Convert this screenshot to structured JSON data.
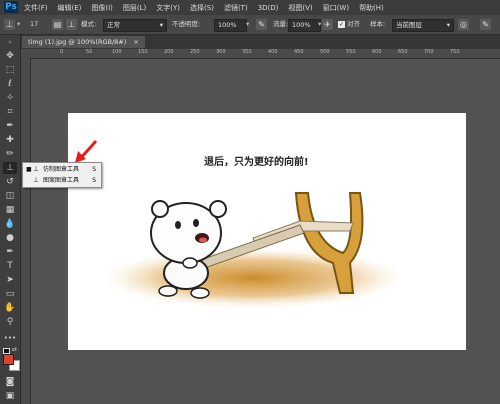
{
  "app": {
    "logo": "Ps"
  },
  "menu": [
    "文件(F)",
    "编辑(E)",
    "图像(I)",
    "图层(L)",
    "文字(Y)",
    "选择(S)",
    "滤镜(T)",
    "3D(D)",
    "视图(V)",
    "窗口(W)",
    "帮助(H)"
  ],
  "options": {
    "brush_size": "17",
    "mode_label": "模式:",
    "mode_value": "正常",
    "opacity_label": "不透明度:",
    "opacity_value": "100%",
    "flow_label": "流量:",
    "flow_value": "100%",
    "aligned_label": "对齐",
    "sample_label": "样本:",
    "sample_value": "当前图层"
  },
  "document": {
    "tab_title": "timg (1).jpg @ 100%(RGB/8#)",
    "close_glyph": "×"
  },
  "ruler": {
    "marks": [
      "0",
      "50",
      "100",
      "150",
      "200",
      "250",
      "300",
      "350",
      "400",
      "450",
      "500",
      "550",
      "600",
      "650",
      "700",
      "750"
    ]
  },
  "image": {
    "caption": "退后，只为更好的向前!"
  },
  "flyout": [
    {
      "label": "仿制图章工具",
      "shortcut": "S",
      "active": true
    },
    {
      "label": "图案图章工具",
      "shortcut": "S",
      "active": false
    }
  ],
  "colors": {
    "foreground": "#e2412d",
    "background": "#ffffff",
    "arrow": "#e0201a",
    "accent": "#31a8ff"
  }
}
